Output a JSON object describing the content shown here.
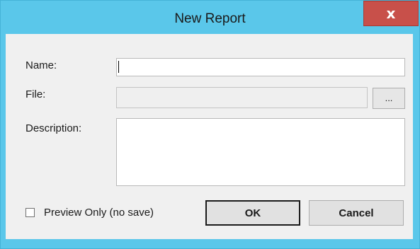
{
  "window": {
    "title": "New Report",
    "close_label": "x"
  },
  "form": {
    "name_label": "Name:",
    "name_value": "",
    "file_label": "File:",
    "file_value": "",
    "browse_label": "...",
    "description_label": "Description:",
    "description_value": "",
    "preview_checkbox_label": "Preview Only (no save)",
    "preview_checked": false
  },
  "buttons": {
    "ok_label": "OK",
    "cancel_label": "Cancel"
  },
  "colors": {
    "titlebar": "#5ac7ea",
    "close_button": "#c8504a",
    "client_background": "#f0f0f0"
  }
}
